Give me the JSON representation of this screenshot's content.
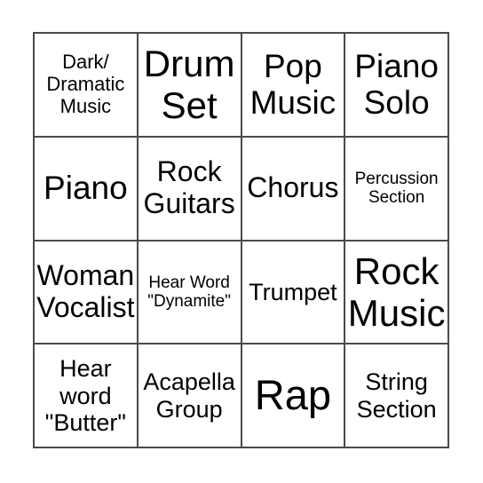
{
  "card": {
    "type": "bingo-card",
    "rows": 4,
    "columns": 4,
    "background_color": "#ffffff",
    "border_color": "#4a4a4a",
    "text_color": "#000000",
    "cells": [
      {
        "text": "Dark/\nDramatic\nMusic",
        "size": "fs-sm",
        "name": "bingo-cell-dark-dramatic-music"
      },
      {
        "text": "Drum\nSet",
        "size": "fs-xxl",
        "name": "bingo-cell-drum-set"
      },
      {
        "text": "Pop\nMusic",
        "size": "fs-xl",
        "name": "bingo-cell-pop-music"
      },
      {
        "text": "Piano\nSolo",
        "size": "fs-xl",
        "name": "bingo-cell-piano-solo"
      },
      {
        "text": "Piano",
        "size": "fs-xl",
        "name": "bingo-cell-piano"
      },
      {
        "text": "Rock\nGuitars",
        "size": "fs-lg",
        "name": "bingo-cell-rock-guitars"
      },
      {
        "text": "Chorus",
        "size": "fs-lg",
        "name": "bingo-cell-chorus"
      },
      {
        "text": "Percussion\nSection",
        "size": "fs-xs",
        "name": "bingo-cell-percussion-section"
      },
      {
        "text": "Woman\nVocalist",
        "size": "fs-lg",
        "name": "bingo-cell-woman-vocalist"
      },
      {
        "text": "Hear Word\n\"Dynamite\"",
        "size": "fs-xs",
        "name": "bingo-cell-hear-word-dynamite"
      },
      {
        "text": "Trumpet",
        "size": "fs-md",
        "name": "bingo-cell-trumpet"
      },
      {
        "text": "Rock\nMusic",
        "size": "fs-xxl",
        "name": "bingo-cell-rock-music"
      },
      {
        "text": "Hear\nword\n\"Butter\"",
        "size": "fs-md",
        "name": "bingo-cell-hear-word-butter"
      },
      {
        "text": "Acapella\nGroup",
        "size": "fs-md",
        "name": "bingo-cell-acapella-group"
      },
      {
        "text": "Rap",
        "size": "fs-max",
        "name": "bingo-cell-rap"
      },
      {
        "text": "String\nSection",
        "size": "fs-md",
        "name": "bingo-cell-string-section"
      }
    ]
  }
}
